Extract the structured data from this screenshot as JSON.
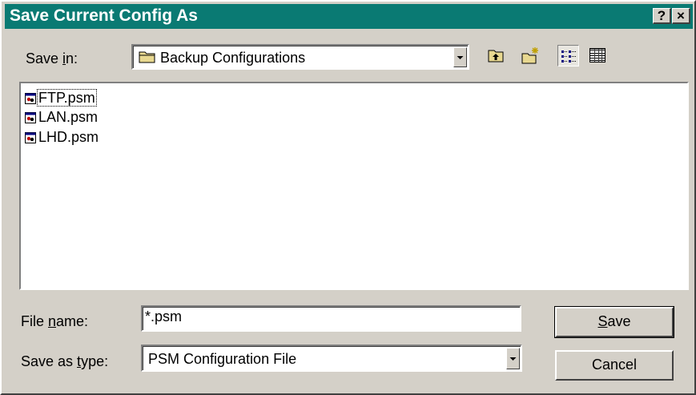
{
  "window": {
    "title": "Save Current Config As",
    "help_button": "?",
    "close_button": "×"
  },
  "save_in": {
    "label_prefix": "Save ",
    "label_accel": "i",
    "label_suffix": "n:",
    "value": "Backup Configurations"
  },
  "toolbar": {
    "buttons": [
      {
        "icon": "up-one-level-icon"
      },
      {
        "icon": "create-new-folder-icon"
      },
      {
        "icon": "list-view-icon"
      },
      {
        "icon": "details-view-icon"
      }
    ]
  },
  "files": [
    {
      "name": "FTP.psm",
      "icon": "psm-file-icon"
    },
    {
      "name": "LAN.psm",
      "icon": "psm-file-icon"
    },
    {
      "name": "LHD.psm",
      "icon": "psm-file-icon"
    }
  ],
  "file_name": {
    "label_prefix": "File ",
    "label_accel": "n",
    "label_suffix": "ame:",
    "value": "*.psm"
  },
  "save_as_type": {
    "label_prefix": "Save as ",
    "label_accel": "t",
    "label_suffix": "ype:",
    "value": "PSM Configuration File"
  },
  "buttons": {
    "save_accel": "S",
    "save_suffix": "ave",
    "cancel": "Cancel"
  },
  "colors": {
    "titlebar": "#0a7a73",
    "face": "#d4d0c8"
  }
}
